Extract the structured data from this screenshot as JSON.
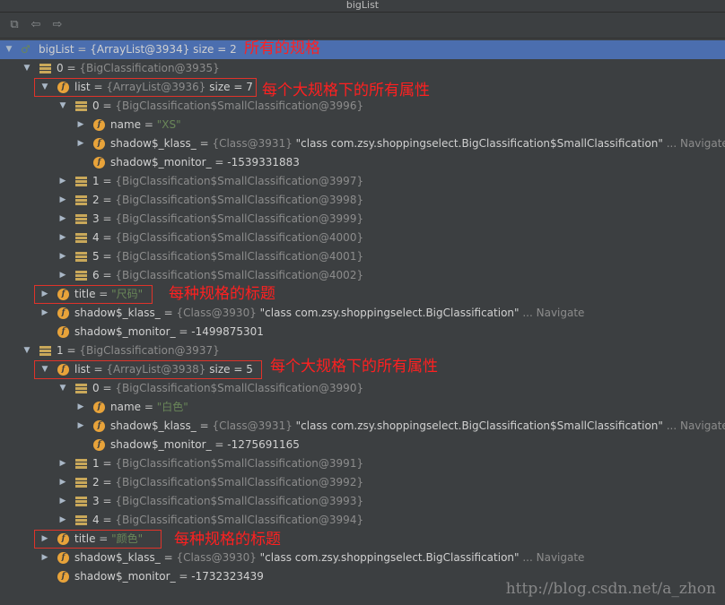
{
  "window": {
    "title": "bigList"
  },
  "rows": [
    {
      "name": "bigList",
      "eq": " = ",
      "ref": "{ArrayList@3934}",
      "extra": "  size = 2"
    },
    {
      "name": "0",
      "eq": " = ",
      "ref": "{BigClassification@3935}"
    },
    {
      "name": "list",
      "eq": " = ",
      "ref": "{ArrayList@3936}",
      "extra": "  size = 7"
    },
    {
      "name": "0",
      "eq": " = ",
      "ref": "{BigClassification$SmallClassification@3996}"
    },
    {
      "name": "name",
      "eq": " = ",
      "str": "\"XS\""
    },
    {
      "name": "shadow$_klass_",
      "eq": " = ",
      "ref": "{Class@3931}",
      "str2": " \"class com.zsy.shoppingselect.BigClassification$SmallClassification\"",
      "nav": " ... Navigate"
    },
    {
      "name": "shadow$_monitor_",
      "eq": " = ",
      "num": "-1539331883"
    },
    {
      "name": "1",
      "eq": " = ",
      "ref": "{BigClassification$SmallClassification@3997}"
    },
    {
      "name": "2",
      "eq": " = ",
      "ref": "{BigClassification$SmallClassification@3998}"
    },
    {
      "name": "3",
      "eq": " = ",
      "ref": "{BigClassification$SmallClassification@3999}"
    },
    {
      "name": "4",
      "eq": " = ",
      "ref": "{BigClassification$SmallClassification@4000}"
    },
    {
      "name": "5",
      "eq": " = ",
      "ref": "{BigClassification$SmallClassification@4001}"
    },
    {
      "name": "6",
      "eq": " = ",
      "ref": "{BigClassification$SmallClassification@4002}"
    },
    {
      "name": "title",
      "eq": " = ",
      "str": "\"尺码\""
    },
    {
      "name": "shadow$_klass_",
      "eq": " = ",
      "ref": "{Class@3930}",
      "str2": " \"class com.zsy.shoppingselect.BigClassification\"",
      "nav": " ... Navigate"
    },
    {
      "name": "shadow$_monitor_",
      "eq": " = ",
      "num": "-1499875301"
    },
    {
      "name": "1",
      "eq": " = ",
      "ref": "{BigClassification@3937}"
    },
    {
      "name": "list",
      "eq": " = ",
      "ref": "{ArrayList@3938}",
      "extra": "  size = 5"
    },
    {
      "name": "0",
      "eq": " = ",
      "ref": "{BigClassification$SmallClassification@3990}"
    },
    {
      "name": "name",
      "eq": " = ",
      "str": "\"白色\""
    },
    {
      "name": "shadow$_klass_",
      "eq": " = ",
      "ref": "{Class@3931}",
      "str2": " \"class com.zsy.shoppingselect.BigClassification$SmallClassification\"",
      "nav": " ... Navigate"
    },
    {
      "name": "shadow$_monitor_",
      "eq": " = ",
      "num": "-1275691165"
    },
    {
      "name": "1",
      "eq": " = ",
      "ref": "{BigClassification$SmallClassification@3991}"
    },
    {
      "name": "2",
      "eq": " = ",
      "ref": "{BigClassification$SmallClassification@3992}"
    },
    {
      "name": "3",
      "eq": " = ",
      "ref": "{BigClassification$SmallClassification@3993}"
    },
    {
      "name": "4",
      "eq": " = ",
      "ref": "{BigClassification$SmallClassification@3994}"
    },
    {
      "name": "title",
      "eq": " = ",
      "str": "\"颜色\""
    },
    {
      "name": "shadow$_klass_",
      "eq": " = ",
      "ref": "{Class@3930}",
      "str2": " \"class com.zsy.shoppingselect.BigClassification\"",
      "nav": " ... Navigate"
    },
    {
      "name": "shadow$_monitor_",
      "eq": " = ",
      "num": "-1732323439"
    }
  ],
  "annotations": {
    "all_specs": "所有的规格",
    "all_attrs_1": "每个大规格下的所有属性",
    "spec_title_1": "每种规格的标题",
    "all_attrs_2": "每个大规格下的所有属性",
    "spec_title_2": "每种规格的标题"
  },
  "watermark": "http://blog.csdn.net/a_zhon",
  "colors": {
    "background": "#3c3f41",
    "selection": "#4b6eaf",
    "annotation": "#ff2020",
    "string": "#6a8759",
    "field_icon": "#e8a33a"
  }
}
